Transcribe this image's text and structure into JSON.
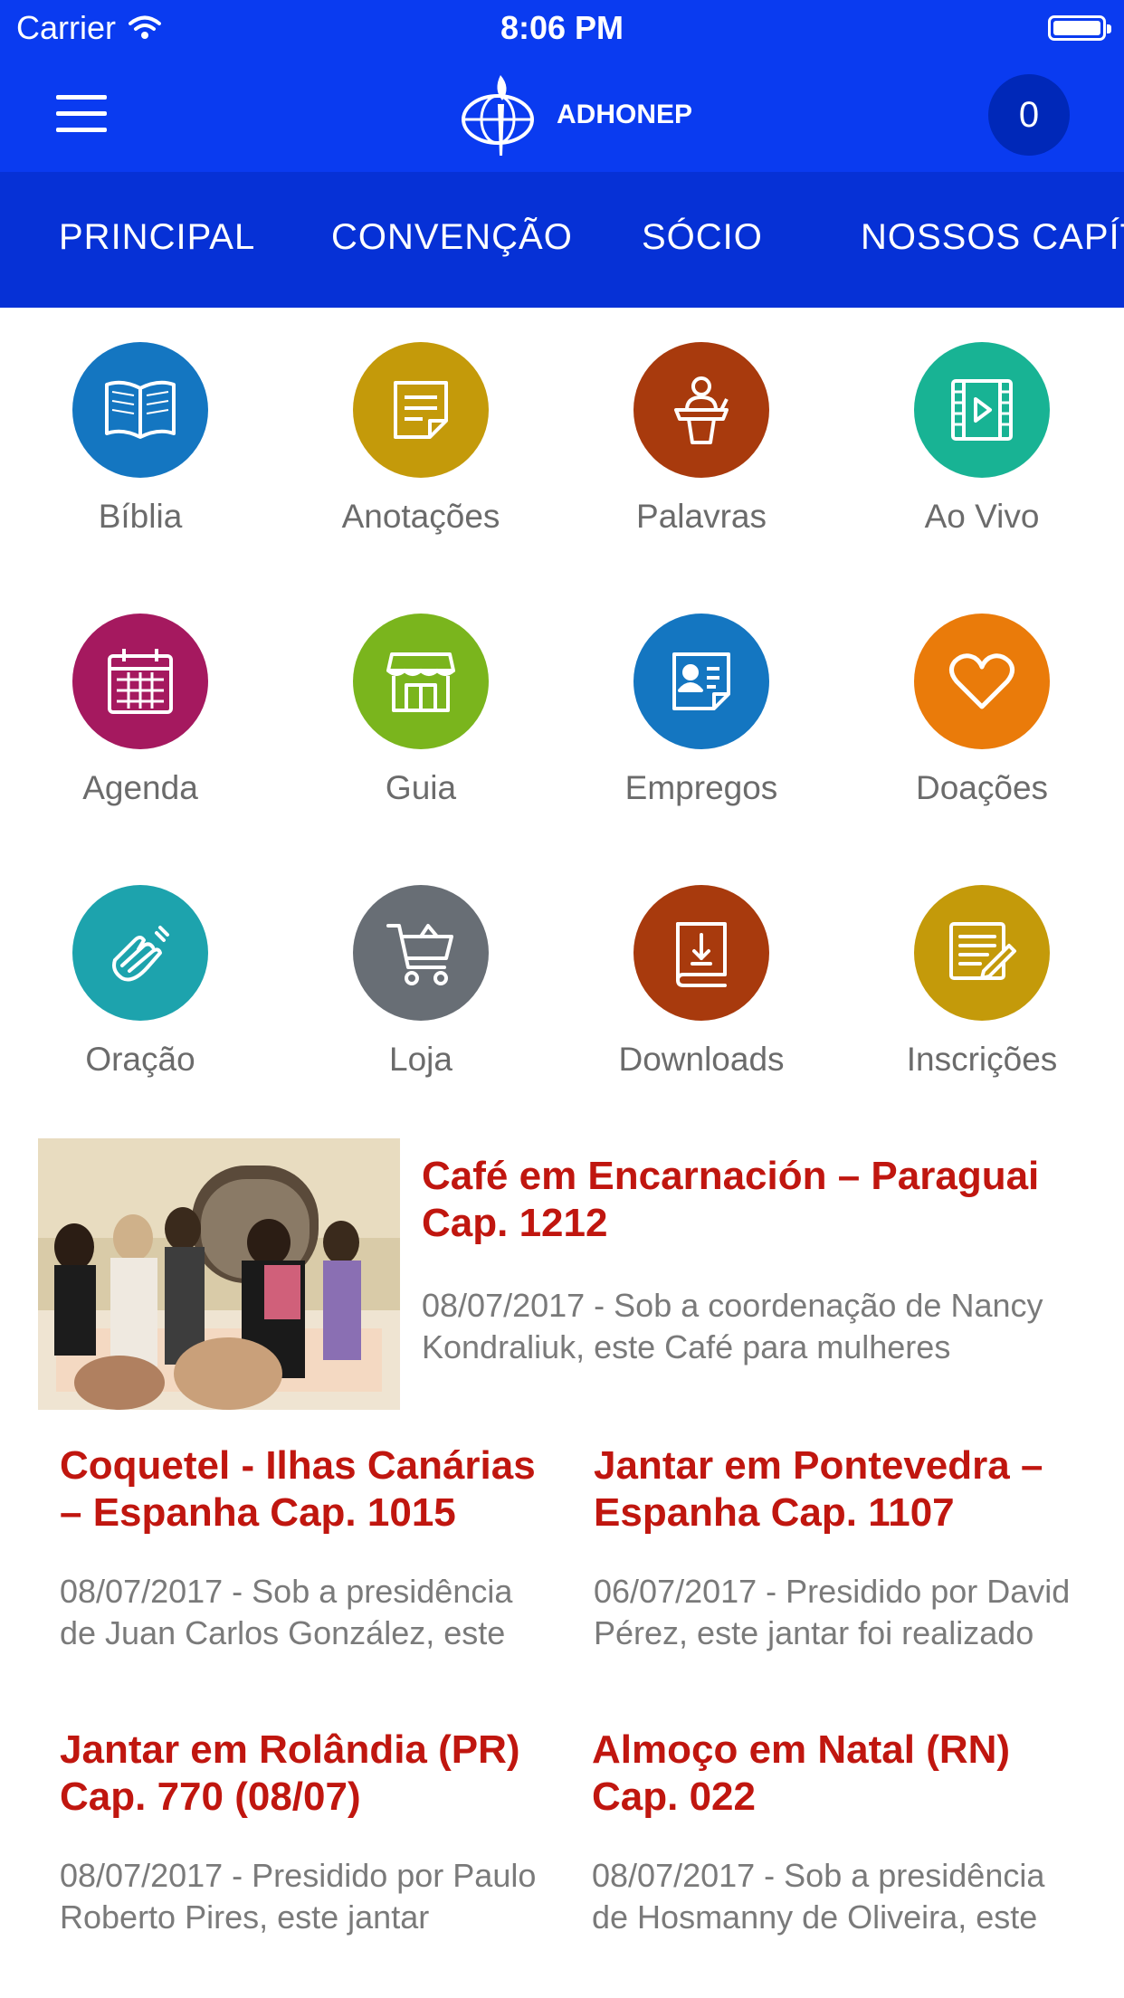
{
  "status_bar": {
    "carrier": "Carrier",
    "time": "8:06 PM"
  },
  "header": {
    "brand": "ADHONEP",
    "cart_count": "0"
  },
  "tabs": [
    {
      "label": "PRINCIPAL"
    },
    {
      "label": "CONVENÇÃO"
    },
    {
      "label": "SÓCIO"
    },
    {
      "label": "NOSSOS CAPÍTULOS"
    }
  ],
  "grid": [
    {
      "label": "Bíblia",
      "icon": "book-icon",
      "color": "#1476c1"
    },
    {
      "label": "Anotações",
      "icon": "note-icon",
      "color": "#c49a0a"
    },
    {
      "label": "Palavras",
      "icon": "speaker-podium-icon",
      "color": "#a83a0d"
    },
    {
      "label": "Ao Vivo",
      "icon": "video-play-icon",
      "color": "#18b394"
    },
    {
      "label": "Agenda",
      "icon": "calendar-icon",
      "color": "#a5195f"
    },
    {
      "label": "Guia",
      "icon": "store-icon",
      "color": "#7ab51d"
    },
    {
      "label": "Empregos",
      "icon": "id-card-icon",
      "color": "#1476c1"
    },
    {
      "label": "Doações",
      "icon": "heart-icon",
      "color": "#ea7b0a"
    },
    {
      "label": "Oração",
      "icon": "praying-hands-icon",
      "color": "#1da3ad"
    },
    {
      "label": "Loja",
      "icon": "cart-icon",
      "color": "#686e75"
    },
    {
      "label": "Downloads",
      "icon": "download-book-icon",
      "color": "#a83a0d"
    },
    {
      "label": "Inscrições",
      "icon": "form-edit-icon",
      "color": "#c49a0a"
    }
  ],
  "featured": {
    "title": "Café em Encarnación – Paraguai Cap. 1212",
    "desc": "08/07/2017 - Sob a coordenação de Nancy Kondraliuk, este Café para mulheres aconteceu"
  },
  "news": [
    {
      "title": "Coquetel - Ilhas Canárias – Espanha Cap. 1015",
      "desc": "08/07/2017 - Sob a presidência de Juan Carlos González, este coquetel"
    },
    {
      "title": "Jantar em Pontevedra – Espanha Cap. 1107",
      "desc": "06/07/2017 - Presidido por David Pérez, este jantar foi realizado"
    },
    {
      "title": "Jantar em Rolândia (PR) Cap. 770 (08/07)",
      "desc": "08/07/2017 - Presidido por Paulo Roberto Pires, este jantar"
    },
    {
      "title": "Almoço em Natal (RN) Cap. 022",
      "desc": "08/07/2017 - Sob a presidência de Hosmanny de Oliveira, este almoço"
    }
  ]
}
